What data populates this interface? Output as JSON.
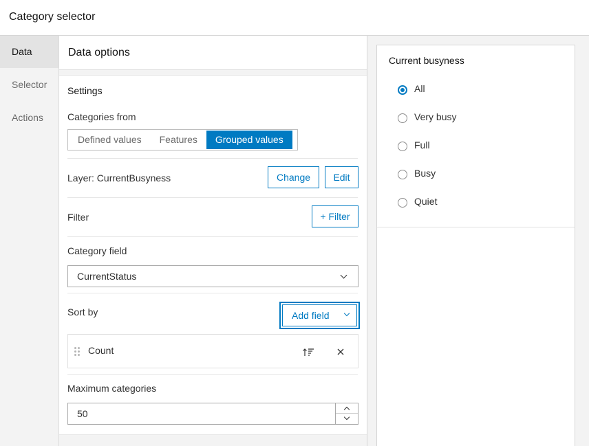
{
  "window": {
    "title": "Category selector"
  },
  "rail": {
    "items": [
      {
        "label": "Data",
        "active": true
      },
      {
        "label": "Selector",
        "active": false
      },
      {
        "label": "Actions",
        "active": false
      }
    ]
  },
  "panel": {
    "title": "Data options",
    "settings_label": "Settings",
    "categories_from": {
      "label": "Categories from",
      "options": [
        "Defined values",
        "Features",
        "Grouped values"
      ],
      "selected": "Grouped values"
    },
    "layer": {
      "label": "Layer: CurrentBusyness",
      "change_label": "Change",
      "edit_label": "Edit"
    },
    "filter": {
      "label": "Filter",
      "button_label": "+ Filter"
    },
    "category_field": {
      "label": "Category field",
      "value": "CurrentStatus"
    },
    "sort_by": {
      "label": "Sort by",
      "add_field_label": "Add field",
      "items": [
        {
          "field": "Count",
          "order": "ascending"
        }
      ]
    },
    "max_categories": {
      "label": "Maximum categories",
      "value": "50"
    }
  },
  "preview": {
    "title": "Current busyness",
    "options": [
      "All",
      "Very busy",
      "Full",
      "Busy",
      "Quiet"
    ],
    "selected": "All"
  },
  "colors": {
    "accent": "#007ac2",
    "rail_bg": "#f3f3f3",
    "text": "#323232"
  }
}
